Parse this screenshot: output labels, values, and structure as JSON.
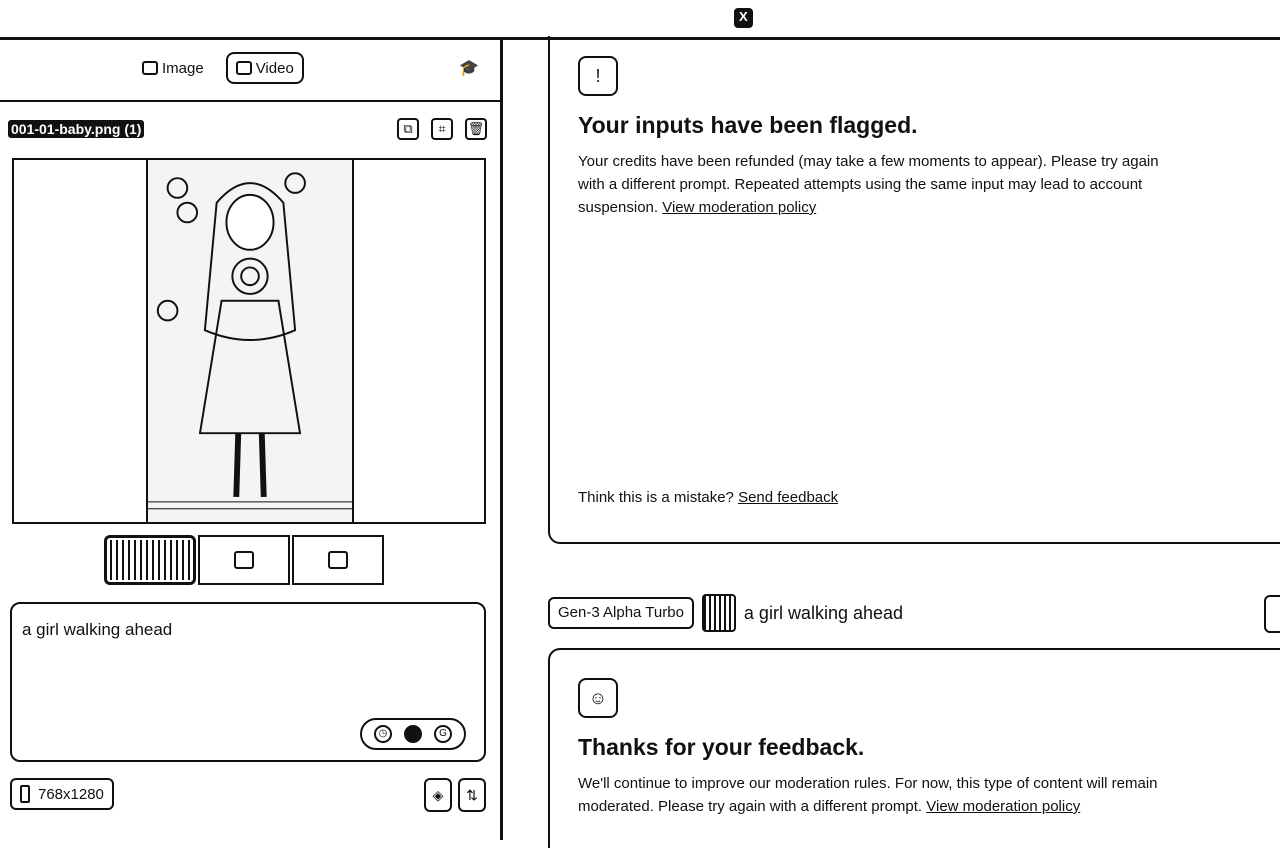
{
  "topbar": {
    "close_label": "X"
  },
  "mode_tabs": [
    {
      "label": "Image",
      "icon": "image-icon",
      "active": false
    },
    {
      "label": "Video",
      "icon": "video-icon",
      "active": true
    }
  ],
  "left": {
    "file_name": "001-01-baby.png (1)",
    "prompt_text": "a girl walking ahead",
    "resolution": "768x1280"
  },
  "flagged_card": {
    "title": "Your inputs have been flagged.",
    "body": "Your credits have been refunded (may take a few moments to appear). Please try again with a different prompt. Repeated attempts using the same input may lead to account suspension.",
    "policy_link": "View moderation policy",
    "mistake_text": "Think this is a mistake?",
    "feedback_link": "Send feedback"
  },
  "generation": {
    "model": "Gen-3 Alpha Turbo",
    "prompt": "a girl walking ahead"
  },
  "feedback_card": {
    "title": "Thanks for your feedback.",
    "body": "We'll continue to improve our moderation rules. For now, this type of content will remain moderated. Please try again with a different prompt.",
    "policy_link": "View moderation policy"
  }
}
